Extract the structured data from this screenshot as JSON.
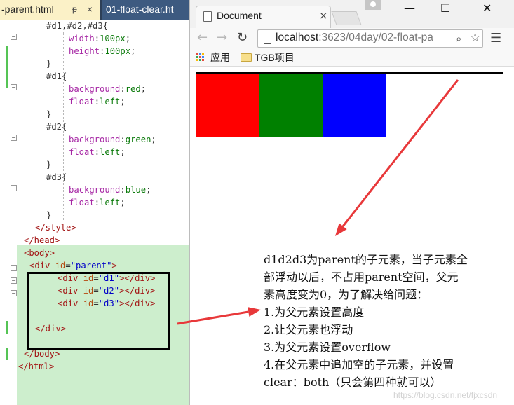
{
  "editor": {
    "tabs": [
      {
        "label": "-parent.html",
        "pin": "ᵽ",
        "close": "×"
      },
      {
        "label": "01-float-clear.ht"
      }
    ],
    "code": [
      {
        "kind": "css",
        "sel": "#d1,#d2,#d3{",
        "indent": 1
      },
      {
        "kind": "decl",
        "prop": "width",
        "val": "100px",
        "indent": 2
      },
      {
        "kind": "decl",
        "prop": "height",
        "val": "100px",
        "indent": 2
      },
      {
        "kind": "plain",
        "text": "}",
        "indent": 1
      },
      {
        "kind": "css",
        "sel": "#d1{",
        "indent": 1
      },
      {
        "kind": "decl",
        "prop": "background",
        "val": "red",
        "indent": 2
      },
      {
        "kind": "decl",
        "prop": "float",
        "val": "left",
        "indent": 2
      },
      {
        "kind": "plain",
        "text": "}",
        "indent": 1
      },
      {
        "kind": "css",
        "sel": "#d2{",
        "indent": 1
      },
      {
        "kind": "decl",
        "prop": "background",
        "val": "green",
        "indent": 2
      },
      {
        "kind": "decl",
        "prop": "float",
        "val": "left",
        "indent": 2
      },
      {
        "kind": "plain",
        "text": "}",
        "indent": 1
      },
      {
        "kind": "css",
        "sel": "#d3{",
        "indent": 1
      },
      {
        "kind": "decl",
        "prop": "background",
        "val": "blue",
        "indent": 2
      },
      {
        "kind": "decl",
        "prop": "float",
        "val": "left",
        "indent": 2
      },
      {
        "kind": "plain",
        "text": "}",
        "indent": 1
      },
      {
        "kind": "tagline",
        "text": "</style>",
        "indent": 0.5
      },
      {
        "kind": "tagline",
        "text": "</head>",
        "indent": 0
      },
      {
        "kind": "tagline",
        "text": "<body>",
        "indent": 0
      },
      {
        "kind": "div",
        "id": "parent",
        "indent": 0.25
      },
      {
        "kind": "div",
        "id": "d1",
        "inner": "</div>",
        "indent": 1.5
      },
      {
        "kind": "div",
        "id": "d2",
        "inner": "</div>",
        "indent": 1.5
      },
      {
        "kind": "div",
        "id": "d3",
        "inner": "</div>",
        "indent": 1.5
      },
      {
        "kind": "plain",
        "text": "",
        "indent": 0
      },
      {
        "kind": "tagline",
        "text": "</div>",
        "indent": 0.5
      },
      {
        "kind": "plain",
        "text": "",
        "indent": 0
      },
      {
        "kind": "tagline",
        "text": "</body>",
        "indent": 0
      },
      {
        "kind": "tagline",
        "text": "</html>",
        "indent": -0.25
      }
    ]
  },
  "browser": {
    "tab_title": "Document",
    "tab_close": "×",
    "url_host": "localhost",
    "url_rest": ":3623/04day/02-float-pa",
    "bookmarks": [
      {
        "label": "应用"
      },
      {
        "label": "TGB项目"
      }
    ],
    "boxes": [
      {
        "name": "d1",
        "color": "#ff0000"
      },
      {
        "name": "d2",
        "color": "#008000"
      },
      {
        "name": "d3",
        "color": "#0000ff"
      }
    ]
  },
  "annotation": {
    "lines": [
      "d1d2d3为parent的子元素，当子元素全",
      "部浮动以后，不占用parent空间，父元",
      "素高度变为0，为了解决给问题：",
      "1.为父元素设置高度",
      "2.让父元素也浮动",
      "3.为父元素设置overflow",
      "4.在父元素中追加空的子元素，并设置",
      "clear：both（只会第四种就可以）"
    ],
    "arrow_color": "#e8383a"
  },
  "watermark": "https://blog.csdn.net/fjxcsdn"
}
